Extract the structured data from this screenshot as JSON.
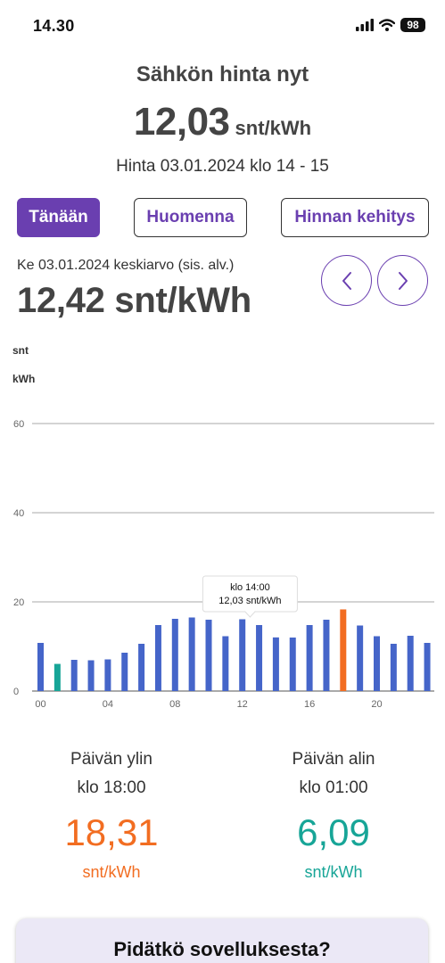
{
  "status_bar": {
    "time": "14.30",
    "battery": "98"
  },
  "header": {
    "title": "Sähkön hinta nyt",
    "price": "12,03",
    "price_unit": "snt/kWh",
    "subtitle": "Hinta 03.01.2024 klo 14 - 15"
  },
  "tabs": [
    {
      "label": "Tänään",
      "active": true
    },
    {
      "label": "Huomenna",
      "active": false
    },
    {
      "label": "Hinnan kehitys",
      "active": false
    }
  ],
  "summary": {
    "date_label": "Ke 03.01.2024 keskiarvo (sis. alv.)",
    "average": "12,42 snt/kWh"
  },
  "colors": {
    "accent": "#6a3fb0",
    "bar": "#4565c9",
    "high": "#f26d21",
    "low": "#17a597"
  },
  "chart_data": {
    "type": "bar",
    "y_unit_line1": "snt",
    "y_unit_line2": "kWh",
    "x": [
      "00",
      "01",
      "02",
      "03",
      "04",
      "05",
      "06",
      "07",
      "08",
      "09",
      "10",
      "11",
      "12",
      "13",
      "14",
      "15",
      "16",
      "17",
      "18",
      "19",
      "20",
      "21",
      "22",
      "23"
    ],
    "x_tick_labels": [
      "00",
      "04",
      "08",
      "12",
      "16",
      "20"
    ],
    "values": [
      10.8,
      6.09,
      7.0,
      6.9,
      7.1,
      8.6,
      10.6,
      14.8,
      16.2,
      16.5,
      16.0,
      12.3,
      16.1,
      14.8,
      12.03,
      12.0,
      14.8,
      16.0,
      18.31,
      14.7,
      12.3,
      10.6,
      12.4,
      10.8
    ],
    "highlight_max_index": 18,
    "highlight_min_index": 1,
    "ylim": [
      0,
      60
    ],
    "yticks": [
      0,
      20,
      40,
      60
    ],
    "grid": true,
    "tooltip": {
      "line1": "klo 14:00",
      "line2": "12,03 snt/kWh",
      "index": 14
    }
  },
  "stats": {
    "high": {
      "label": "Päivän ylin",
      "time": "klo 18:00",
      "value": "18,31",
      "unit": "snt/kWh"
    },
    "low": {
      "label": "Päivän alin",
      "time": "klo 01:00",
      "value": "6,09",
      "unit": "snt/kWh"
    }
  },
  "bottom_card": {
    "title": "Pidätkö sovelluksesta?"
  }
}
